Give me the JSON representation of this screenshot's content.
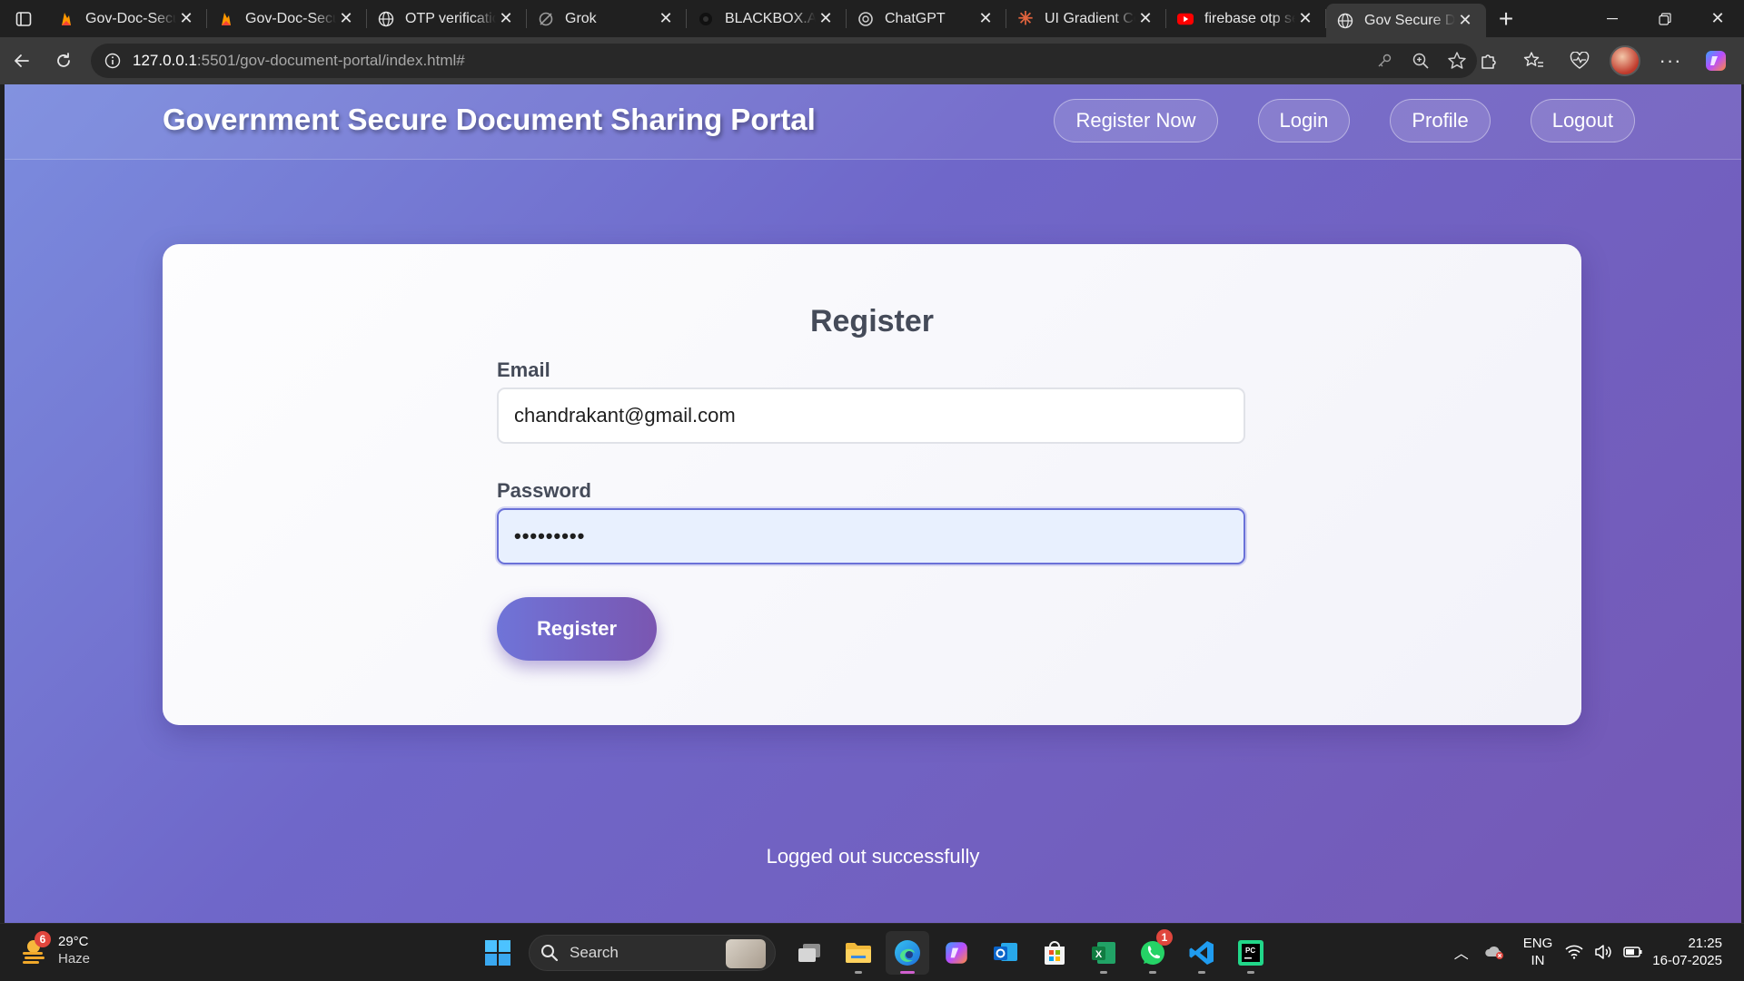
{
  "browser": {
    "tabs": [
      {
        "title": "Gov-Doc-Secur",
        "icon": "firebase-icon"
      },
      {
        "title": "Gov-Doc-Secur",
        "icon": "firebase-icon"
      },
      {
        "title": "OTP verificatio",
        "icon": "globe-icon"
      },
      {
        "title": "Grok",
        "icon": "grok-icon"
      },
      {
        "title": "BLACKBOX.AI",
        "icon": "blackbox-icon"
      },
      {
        "title": "ChatGPT",
        "icon": "chatgpt-icon"
      },
      {
        "title": "UI Gradient Co",
        "icon": "asterisk-icon"
      },
      {
        "title": "firebase otp se",
        "icon": "youtube-icon"
      },
      {
        "title": "Gov Secure Do",
        "icon": "globe-icon",
        "active": true
      }
    ],
    "url_host": "127.0.0.1",
    "url_path": ":5501/gov-document-portal/index.html#"
  },
  "site": {
    "title": "Government Secure Document Sharing Portal",
    "nav": [
      "Register Now",
      "Login",
      "Profile",
      "Logout"
    ]
  },
  "form": {
    "title": "Register",
    "email_label": "Email",
    "email_value": "chandrakant@gmail.com",
    "password_label": "Password",
    "password_masked": "•••••••••",
    "submit_label": "Register"
  },
  "status_message": "Logged out successfully",
  "taskbar": {
    "weather_badge": "6",
    "temperature": "29°C",
    "condition": "Haze",
    "search_label": "Search",
    "whatsapp_badge": "1",
    "lang_top": "ENG",
    "lang_bottom": "IN",
    "time": "21:25",
    "date": "16-07-2025"
  },
  "colors": {
    "gradient_start": "#7b8cde",
    "gradient_end": "#7558b5",
    "text_dark": "#454b59",
    "button_start": "#6f74d8",
    "button_end": "#7a56b1"
  }
}
